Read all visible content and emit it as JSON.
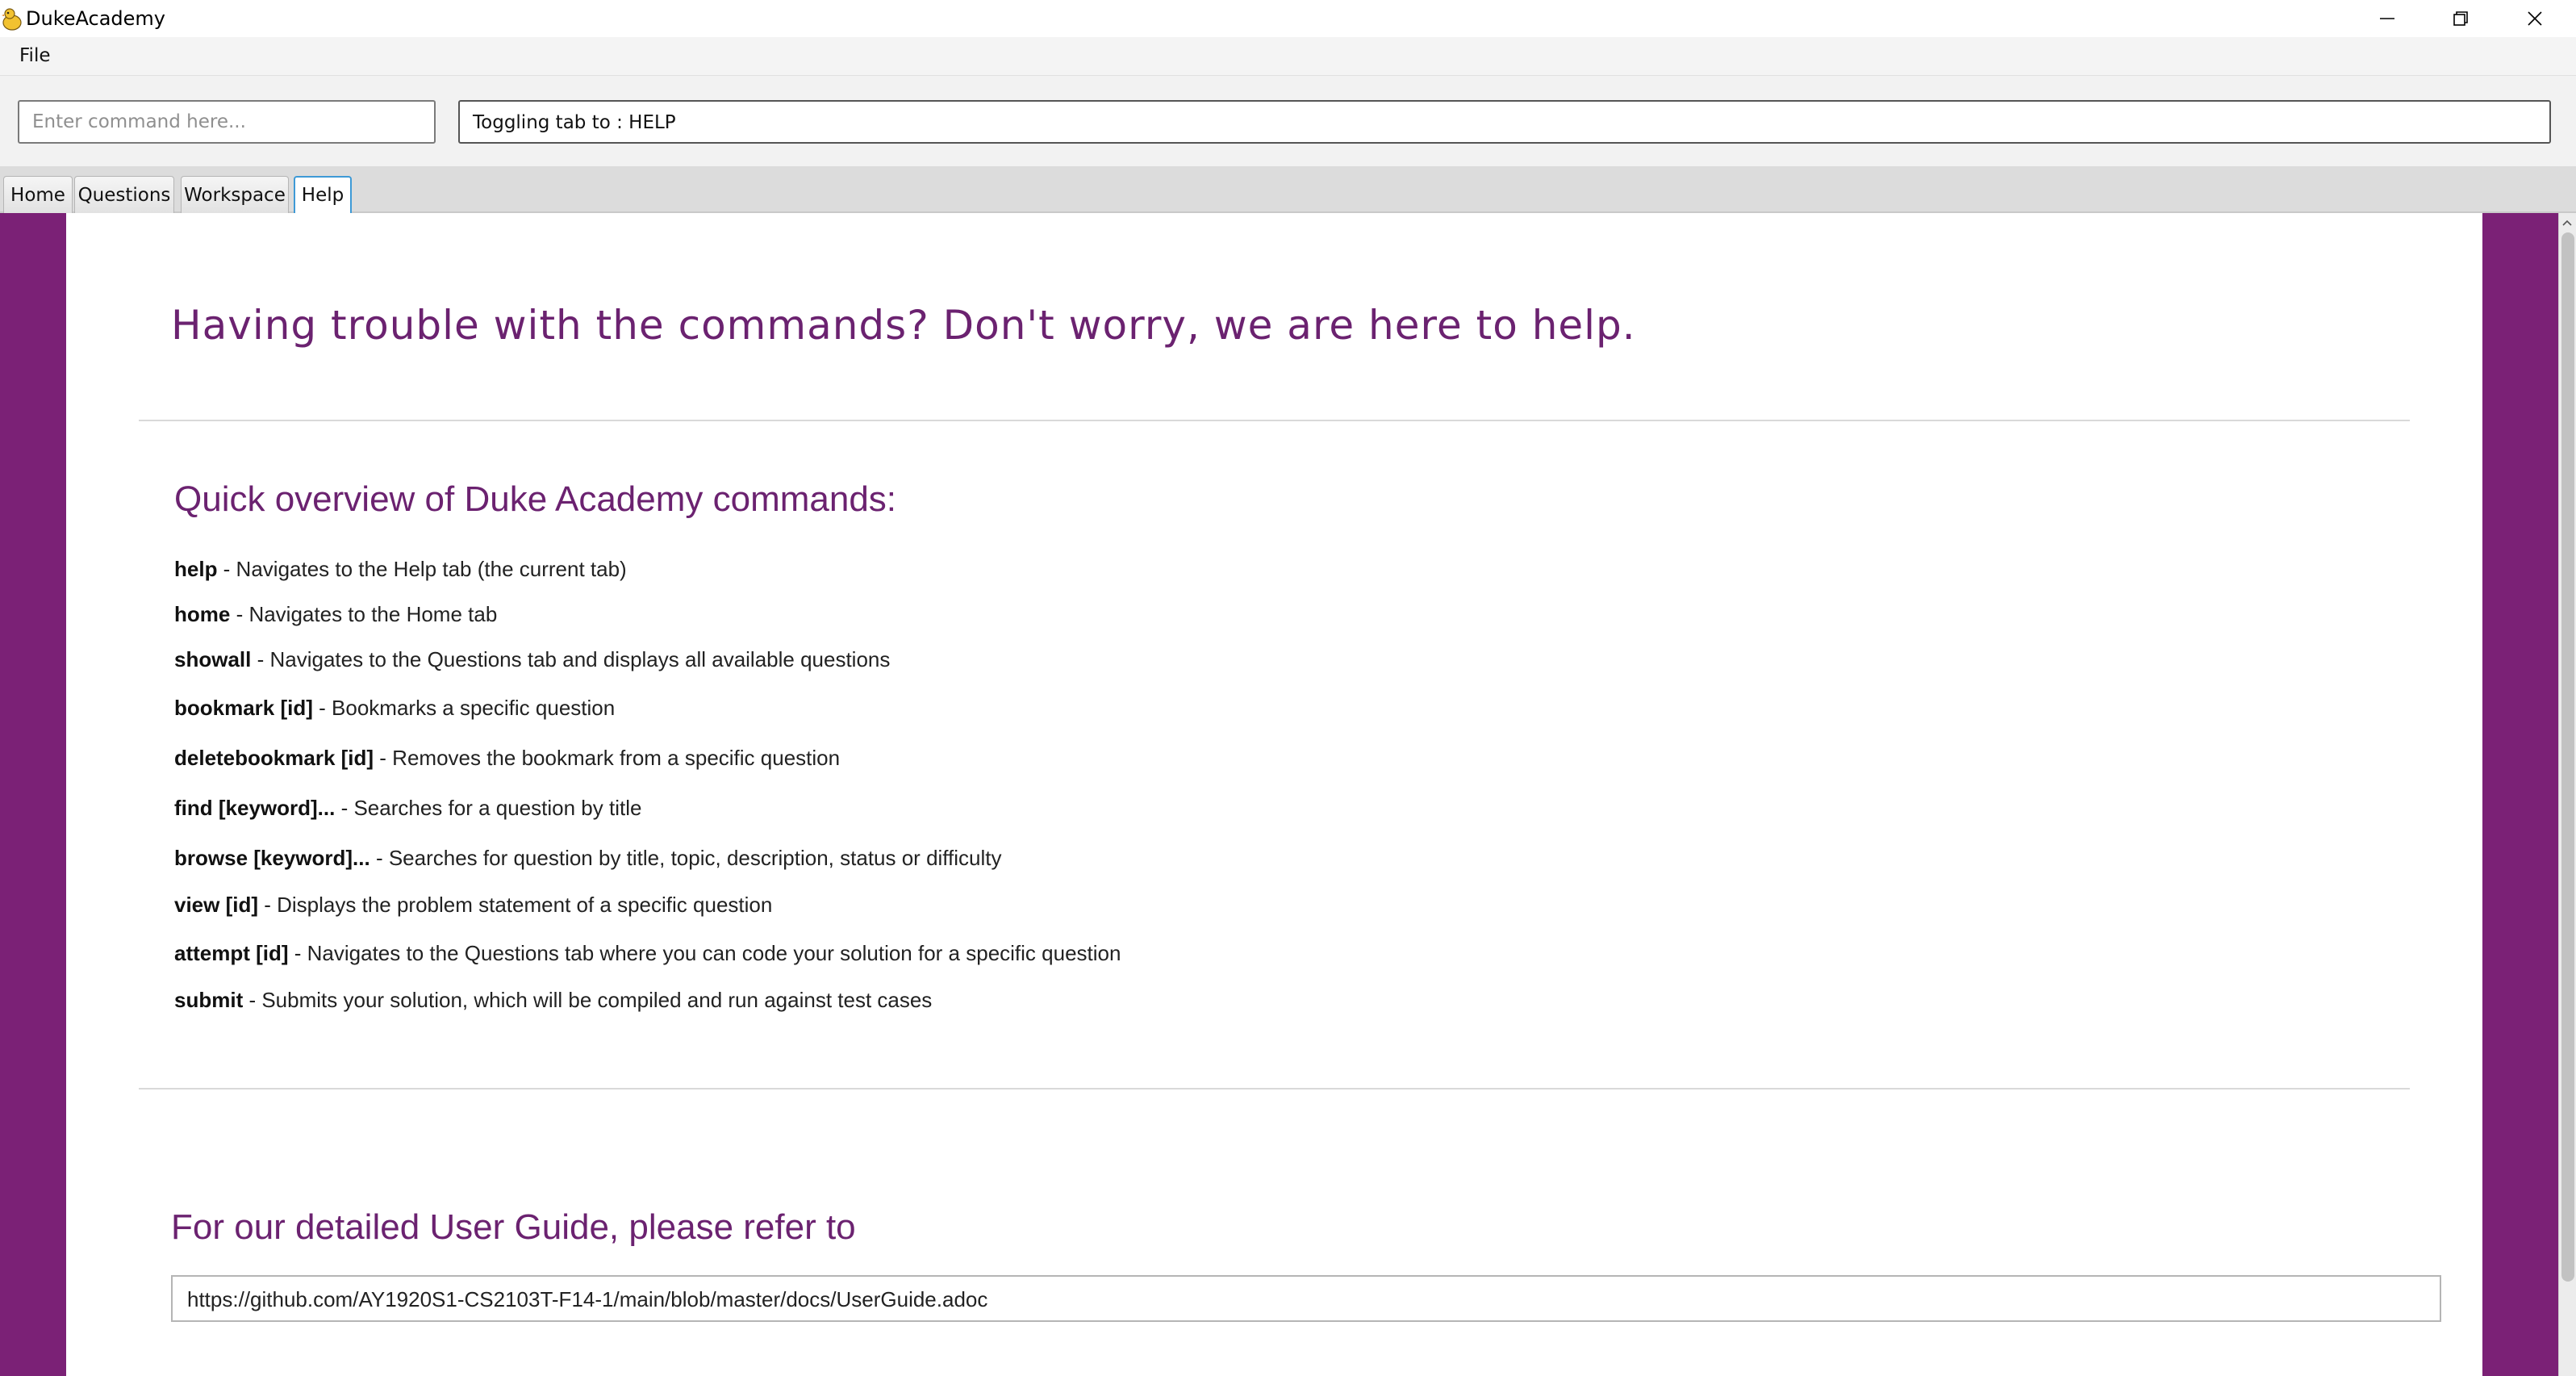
{
  "window": {
    "title": "DukeAcademy",
    "icon": "duck-app-icon",
    "controls": [
      "minimize-icon",
      "restore-icon",
      "close-icon"
    ]
  },
  "menu": {
    "file_label": "File"
  },
  "command": {
    "placeholder": "Enter command here...",
    "value": "",
    "result_text": "Toggling tab to : HELP"
  },
  "tabs": [
    {
      "label": "Home",
      "active": false
    },
    {
      "label": "Questions",
      "active": false
    },
    {
      "label": "Workspace",
      "active": false
    },
    {
      "label": "Help",
      "active": true
    }
  ],
  "help": {
    "heading": "Having trouble with the commands? Don't worry, we are here to help.",
    "overview_heading": "Quick overview of Duke Academy commands:",
    "commands": [
      {
        "keyword": "help",
        "description": " - Navigates to the Help tab (the current tab)"
      },
      {
        "keyword": "home",
        "description": " - Navigates to the Home tab"
      },
      {
        "keyword": "showall",
        "description": " - Navigates to the Questions tab and displays all available questions"
      },
      {
        "keyword": "bookmark [id]",
        "description": " - Bookmarks a specific question"
      },
      {
        "keyword": "deletebookmark [id]",
        "description": " - Removes the bookmark from a specific question"
      },
      {
        "keyword": "find [keyword]...",
        "description": " - Searches for a question by title"
      },
      {
        "keyword": "browse [keyword]...",
        "description": " - Searches for question by title, topic, description, status or difficulty"
      },
      {
        "keyword": "view [id]",
        "description": " - Displays the problem statement of a specific question"
      },
      {
        "keyword": "attempt [id]",
        "description": " - Navigates to the Questions tab where you can code your solution for a specific question"
      },
      {
        "keyword": "submit",
        "description": " - Submits your solution, which will be compiled and run against test cases"
      }
    ],
    "guide_heading": "For our detailed User Guide, please refer to",
    "guide_url": "https://github.com/AY1920S1-CS2103T-F14-1/main/blob/master/docs/UserGuide.adoc"
  },
  "colors": {
    "accent_purple": "#7b2176",
    "heading_purple": "#6b2270",
    "active_tab_border": "#3e9ad6"
  }
}
